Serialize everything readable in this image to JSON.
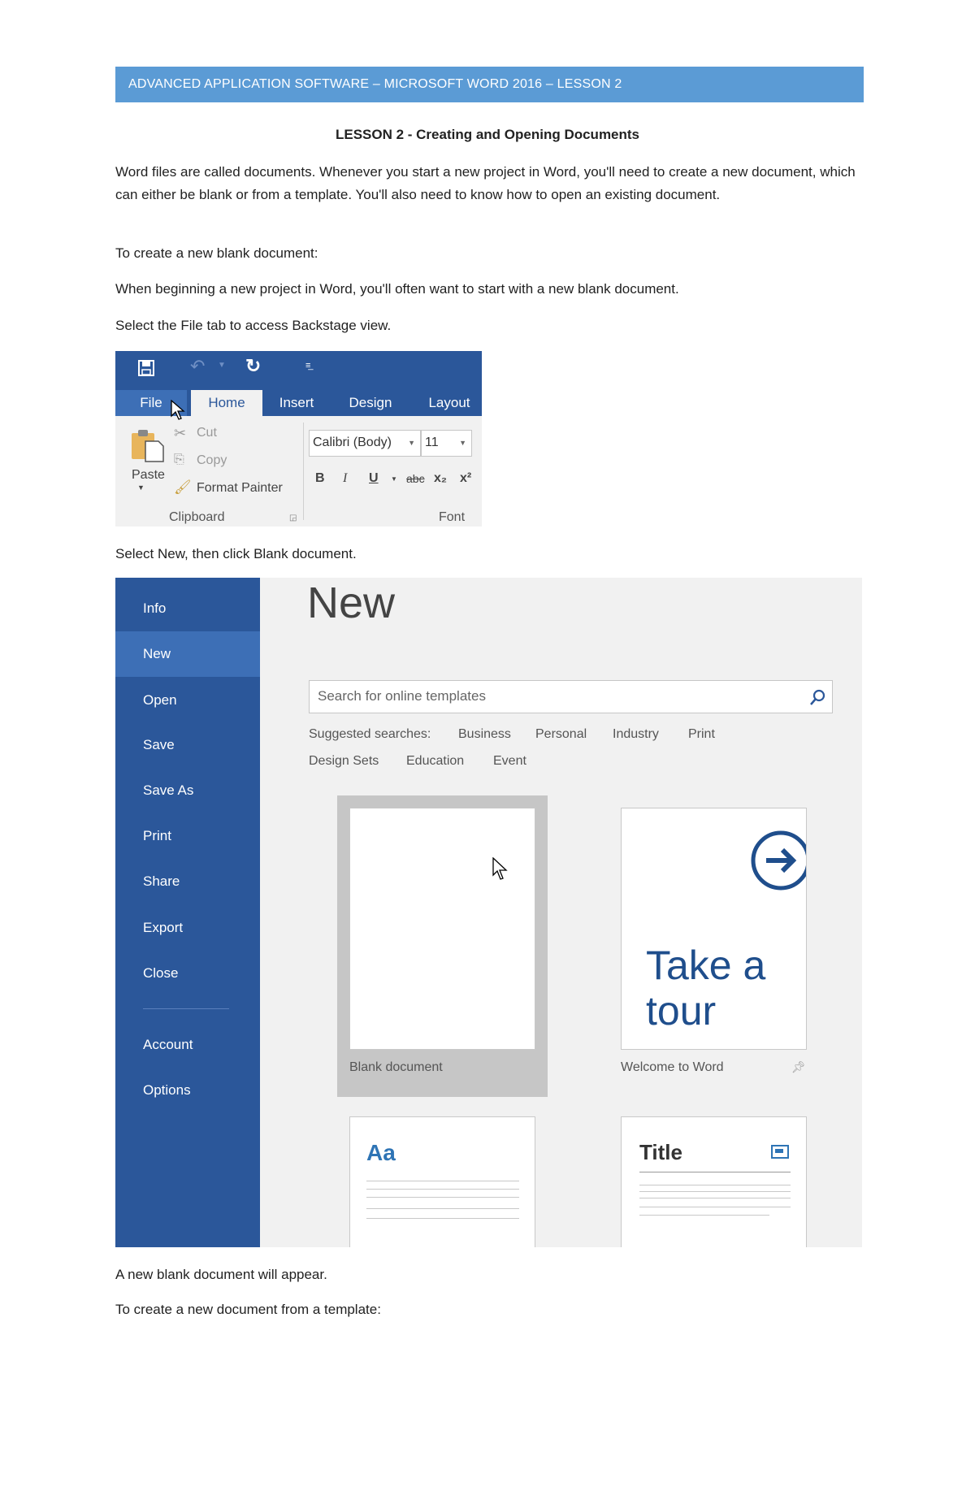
{
  "header": "ADVANCED APPLICATION SOFTWARE – MICROSOFT WORD 2016 – LESSON 2",
  "title": "LESSON 2 - Creating and Opening Documents",
  "paragraphs": {
    "intro": "Word files are called documents. Whenever you start a new project in Word, you'll need to create a new document, which can either be blank or from a template. You'll also need to know how to open an existing document.",
    "blank_heading": "To create a new blank document:",
    "blank_desc": "When beginning a new project in Word, you'll often want to start with a new blank document.",
    "step1": "Select the File tab to access Backstage view.",
    "step2": "Select New, then click Blank document.",
    "result": "A new blank document will appear.",
    "template_heading": "To create a new document from a template:"
  },
  "ribbon": {
    "tabs": [
      "File",
      "Home",
      "Insert",
      "Design",
      "Layout"
    ],
    "clipboard": {
      "paste": "Paste",
      "cut": "Cut",
      "copy": "Copy",
      "format_painter": "Format Painter",
      "group": "Clipboard"
    },
    "font": {
      "name": "Calibri (Body)",
      "size": "11",
      "group": "Font",
      "bold": "B",
      "italic": "I",
      "underline": "U",
      "strike": "abc",
      "sub": "x₂",
      "sup": "x²"
    }
  },
  "backstage": {
    "menu": [
      "Info",
      "New",
      "Open",
      "Save",
      "Save As",
      "Print",
      "Share",
      "Export",
      "Close",
      "Account",
      "Options"
    ],
    "active": "New",
    "heading": "New",
    "search_placeholder": "Search for online templates",
    "suggested_label": "Suggested searches:",
    "suggested": [
      "Business",
      "Personal",
      "Industry",
      "Print",
      "Design Sets",
      "Education",
      "Event"
    ],
    "templates": {
      "blank": "Blank document",
      "tour": "Welcome to Word",
      "tour_text1": "Take a",
      "tour_text2": "tour",
      "aa": "Aa",
      "title": "Title"
    }
  },
  "colors": {
    "header": "#5b9bd5",
    "word_blue": "#2b579a",
    "active": "#3d6fb6"
  }
}
